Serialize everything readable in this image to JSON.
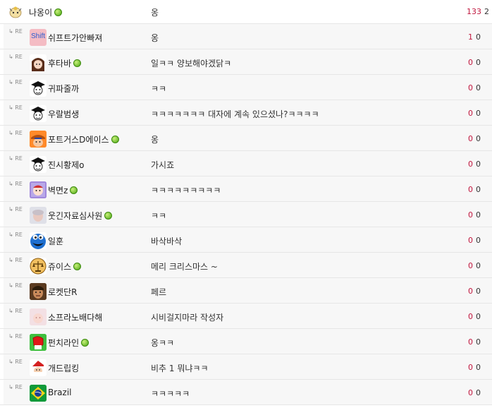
{
  "comments": [
    {
      "nick": "나옹이",
      "online": true,
      "text": "옹",
      "up": "133",
      "down": "2",
      "reply": false,
      "avatar_icon": "meowth-avatar-icon"
    },
    {
      "nick": "쉬프트가안빠져",
      "online": false,
      "text": "옹",
      "up": "1",
      "down": "0",
      "reply": true,
      "avatar_icon": "shift-key-avatar-icon",
      "avatar_text": "Shift"
    },
    {
      "nick": "후타바",
      "online": true,
      "text": "일ㅋㅋ 양보해야겠닭ㅋ",
      "up": "0",
      "down": "0",
      "reply": true,
      "avatar_icon": "anime-girl-avatar-icon"
    },
    {
      "nick": "귀파줄까",
      "online": false,
      "text": "ㅋㅋ",
      "up": "0",
      "down": "0",
      "reply": true,
      "avatar_icon": "graduate-avatar-icon"
    },
    {
      "nick": "우랄범생",
      "online": false,
      "text": "ㅋㅋㅋㅋㅋㅋㅋ 대자에 계속 있으셨나?ㅋㅋㅋㅋ",
      "up": "0",
      "down": "0",
      "reply": true,
      "avatar_icon": "graduate-avatar-icon"
    },
    {
      "nick": "포트거스D에이스",
      "online": true,
      "text": "옹",
      "up": "0",
      "down": "0",
      "reply": true,
      "avatar_icon": "pirate-avatar-icon"
    },
    {
      "nick": "진시황제o",
      "online": false,
      "text": "가시죠",
      "up": "0",
      "down": "0",
      "reply": true,
      "avatar_icon": "graduate-avatar-icon"
    },
    {
      "nick": "벽면z",
      "online": true,
      "text": "ㅋㅋㅋㅋㅋㅋㅋㅋㅋ",
      "up": "0",
      "down": "0",
      "reply": true,
      "avatar_icon": "cartoon-face-avatar-icon"
    },
    {
      "nick": "웃긴자료심사원",
      "online": true,
      "text": "ㅋㅋ",
      "up": "0",
      "down": "0",
      "reply": true,
      "avatar_icon": "blurred-face-avatar-icon"
    },
    {
      "nick": "일훈",
      "online": false,
      "text": "바삭바삭",
      "up": "0",
      "down": "0",
      "reply": true,
      "avatar_icon": "cookie-monster-avatar-icon"
    },
    {
      "nick": "쥬이스",
      "online": true,
      "text": "메리 크리스마스 ~",
      "up": "0",
      "down": "0",
      "reply": true,
      "avatar_icon": "scales-avatar-icon"
    },
    {
      "nick": "로켓단R",
      "online": false,
      "text": "페르",
      "up": "0",
      "down": "0",
      "reply": true,
      "avatar_icon": "man-face-avatar-icon"
    },
    {
      "nick": "소프라노배다해",
      "online": false,
      "text": "시비걸지마라 작성자",
      "up": "0",
      "down": "0",
      "reply": true,
      "avatar_icon": "pale-face-avatar-icon"
    },
    {
      "nick": "펀치라인",
      "online": true,
      "text": "옹ㅋㅋ",
      "up": "0",
      "down": "0",
      "reply": true,
      "avatar_icon": "red-boxing-glove-avatar-icon"
    },
    {
      "nick": "개드립킹",
      "online": false,
      "text": "비추 1 뭐냐ㅋㅋ",
      "up": "0",
      "down": "0",
      "reply": true,
      "avatar_icon": "santa-avatar-icon"
    },
    {
      "nick": "Brazil",
      "online": false,
      "text": "ㅋㅋㅋㅋㅋ",
      "up": "0",
      "down": "0",
      "reply": true,
      "avatar_icon": "brazil-flag-avatar-icon"
    }
  ],
  "reply_marker": "RE",
  "colors": {
    "upvote": "#c0173e",
    "online_dot": "#4aa512",
    "reply_bg": "#f7f7f7"
  }
}
